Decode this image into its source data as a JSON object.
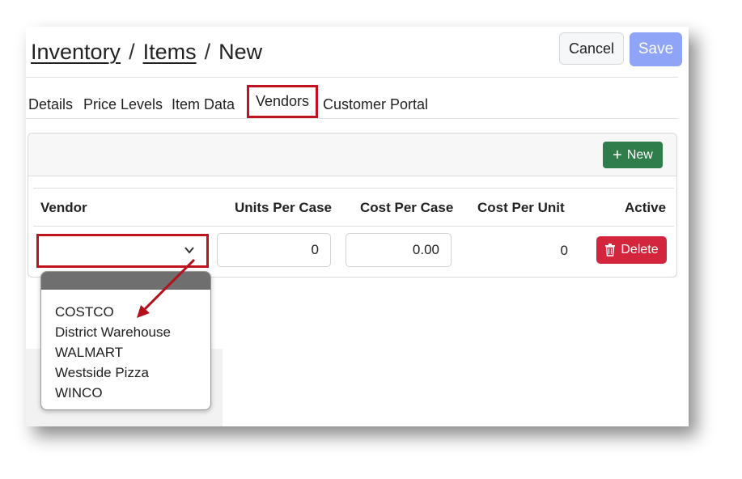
{
  "breadcrumb": {
    "root": "Inventory",
    "section": "Items",
    "current": "New",
    "separator": "/"
  },
  "actions": {
    "cancel": "Cancel",
    "save": "Save"
  },
  "tabs": [
    {
      "label": "Details"
    },
    {
      "label": "Price Levels"
    },
    {
      "label": "Item Data"
    },
    {
      "label": "Vendors",
      "active": true
    },
    {
      "label": "Customer Portal"
    }
  ],
  "card": {
    "new_button": "New",
    "new_icon": "plus-icon"
  },
  "table": {
    "headers": {
      "vendor": "Vendor",
      "units_per_case": "Units Per Case",
      "cost_per_case": "Cost Per Case",
      "cost_per_unit": "Cost Per Unit",
      "active": "Active"
    },
    "row": {
      "vendor": "",
      "units_per_case": "0",
      "cost_per_case": "0.00",
      "cost_per_unit": "0",
      "delete": "Delete",
      "delete_icon": "trash-icon"
    }
  },
  "vendor_options": [
    "COSTCO",
    "District Warehouse",
    "WALMART",
    "Westside Pizza",
    "WINCO"
  ],
  "colors": {
    "save": "#8fa3f7",
    "new": "#2e7d4b",
    "delete": "#d3263c",
    "highlight": "#c0131e"
  }
}
